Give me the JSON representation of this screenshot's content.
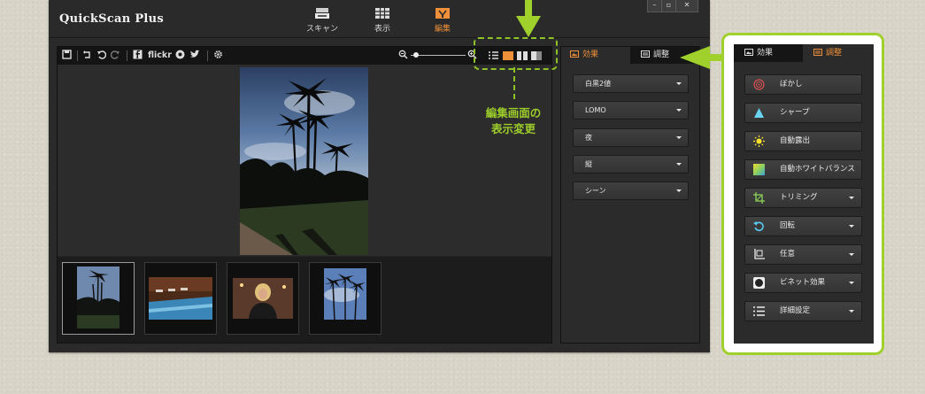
{
  "app": {
    "title": "QuickScan Plus",
    "modes": [
      {
        "label": "スキャン",
        "icon": "scanner-icon",
        "active": false
      },
      {
        "label": "表示",
        "icon": "grid-view-icon",
        "active": false
      },
      {
        "label": "編集",
        "icon": "edit-icon",
        "active": true
      }
    ],
    "window_controls": [
      "minimize-icon",
      "restore-icon",
      "close-icon"
    ]
  },
  "toolbar": {
    "flickr_label": "flickr",
    "icons": [
      "save-icon",
      "revert-icon",
      "undo-icon",
      "redo-icon",
      "facebook-icon",
      "flickr-icon",
      "picasa-icon",
      "twitter-icon",
      "settings-icon",
      "zoom-out-icon",
      "zoom-in-icon"
    ],
    "zoom_level": 0.05,
    "view_modes": [
      "grid-view-icon",
      "single-view-icon",
      "dual-view-icon",
      "compare-view-icon"
    ]
  },
  "small_panel": {
    "tabs": [
      {
        "label": "効果",
        "active": true
      },
      {
        "label": "調整",
        "active": false
      }
    ],
    "dropdowns": [
      "白黒2値",
      "LOMO",
      "夜",
      "縦",
      "シーン"
    ]
  },
  "callout": {
    "line1": "編集画面の",
    "line2": "表示変更"
  },
  "big_panel": {
    "tabs": [
      {
        "label": "効果",
        "active": false
      },
      {
        "label": "調整",
        "active": true
      }
    ],
    "buttons": [
      {
        "label": "ぼかし",
        "icon": "blur-icon",
        "dropdown": false
      },
      {
        "label": "シャープ",
        "icon": "sharpen-icon",
        "dropdown": false
      },
      {
        "label": "自動露出",
        "icon": "sun-icon",
        "dropdown": false
      },
      {
        "label": "自動ホワイトバランス",
        "icon": "white-balance-icon",
        "dropdown": false
      },
      {
        "label": "トリミング",
        "icon": "crop-icon",
        "dropdown": true
      },
      {
        "label": "回転",
        "icon": "rotate-icon",
        "dropdown": true
      },
      {
        "label": "任意",
        "icon": "custom-icon",
        "dropdown": true
      },
      {
        "label": "ビネット効果",
        "icon": "vignette-icon",
        "dropdown": true
      },
      {
        "label": "詳細設定",
        "icon": "list-icon",
        "dropdown": true
      }
    ]
  },
  "colors": {
    "accent_orange": "#f0903a",
    "highlight_green": "#9fd02b",
    "app_bg": "#2a2a2a"
  }
}
